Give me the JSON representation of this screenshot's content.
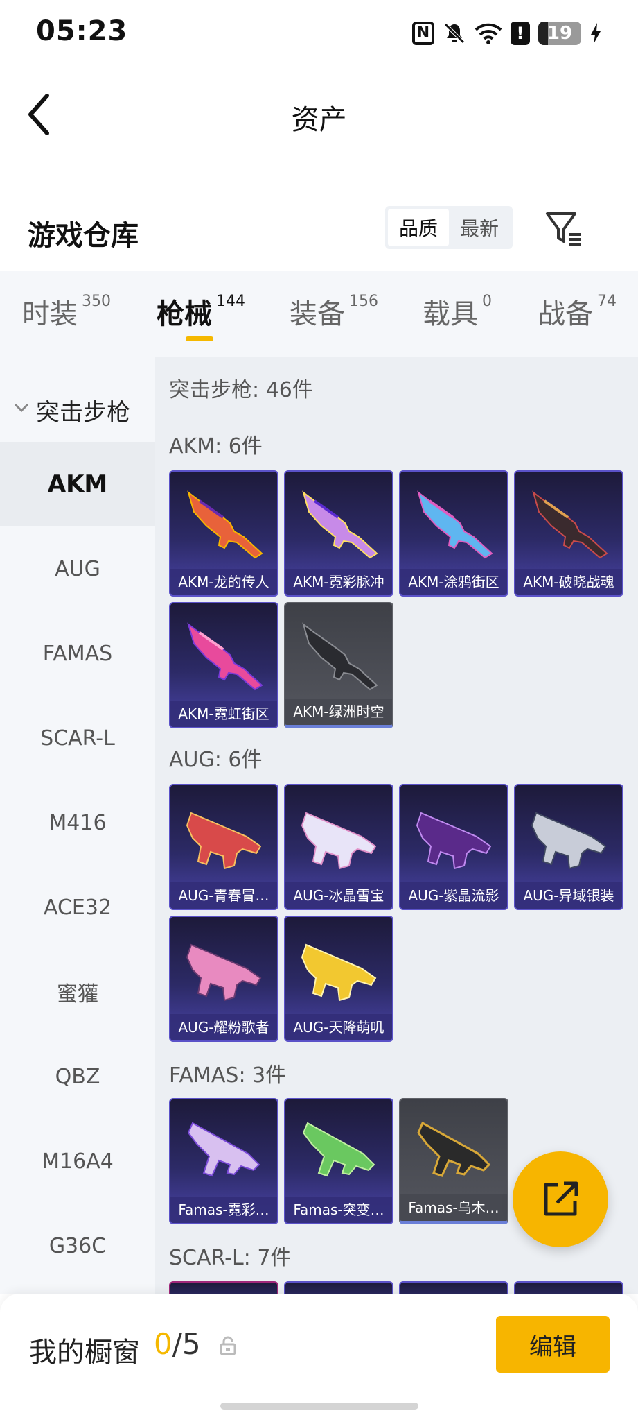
{
  "status": {
    "time": "05:23",
    "battery": "19"
  },
  "header": {
    "title": "资产"
  },
  "warehouse": {
    "title": "游戏仓库",
    "sort_options": [
      "品质",
      "最新"
    ]
  },
  "tabs": [
    {
      "label": "时装",
      "count": "350"
    },
    {
      "label": "枪械",
      "count": "144"
    },
    {
      "label": "装备",
      "count": "156"
    },
    {
      "label": "载具",
      "count": "0"
    },
    {
      "label": "战备",
      "count": "74"
    }
  ],
  "sidebar": {
    "group": "突击步枪",
    "items": [
      "AKM",
      "AUG",
      "FAMAS",
      "SCAR-L",
      "M416",
      "ACE32",
      "蜜獾",
      "QBZ",
      "M16A4",
      "G36C"
    ]
  },
  "content": {
    "summary": "突击步枪: 46件",
    "sections": [
      {
        "label": "AKM: 6件",
        "items": [
          "AKM-龙的传人",
          "AKM-霓彩脉冲",
          "AKM-涂鸦街区",
          "AKM-破晓战魂",
          "AKM-霓虹街区",
          "AKM-绿洲时空"
        ]
      },
      {
        "label": "AUG: 6件",
        "items": [
          "AUG-青春冒…",
          "AUG-冰晶雪宝",
          "AUG-紫晶流影",
          "AUG-异域银装",
          "AUG-耀粉歌者",
          "AUG-天降萌叽"
        ]
      },
      {
        "label": "FAMAS: 3件",
        "items": [
          "Famas-霓彩…",
          "Famas-突变…",
          "Famas-乌木…"
        ]
      },
      {
        "label": "SCAR-L: 7件",
        "items": []
      }
    ]
  },
  "bottom": {
    "title": "我的橱窗",
    "current": "0",
    "total": "/5",
    "edit_label": "编辑"
  },
  "colors": {
    "accent": "#f7b500",
    "card_purple": "#2c2a66",
    "card_gray": "#4a4c53"
  }
}
